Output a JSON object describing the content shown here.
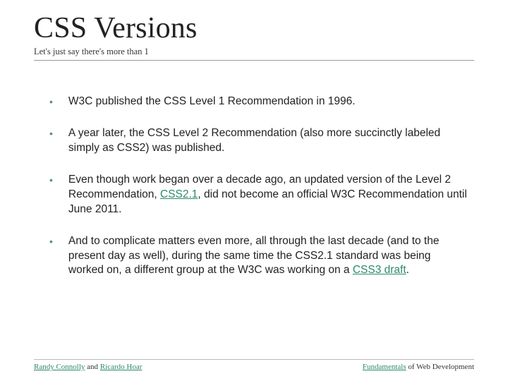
{
  "header": {
    "title": "CSS Versions",
    "subtitle": "Let's just say there's more than 1"
  },
  "bullets": [
    {
      "text": "W3C published the CSS Level 1 Recommendation in 1996."
    },
    {
      "text": "A year later, the CSS Level 2 Recommendation (also more succinctly labeled simply as CSS2) was published."
    }
  ],
  "bullet3": {
    "pre": "Even though work began over a decade ago, an updated version of the Level 2 Recommendation, ",
    "link": "CSS2.1",
    "post": ", did not become an official W3C Recommendation until June 2011."
  },
  "bullet4": {
    "pre": "And to complicate matters even more, all through the last decade (and to the present day as well), during the same time the CSS2.1 standard was being worked on, a different group at the W3C was working on a ",
    "link": "CSS3 draft",
    "post": "."
  },
  "footer": {
    "left_link1": "Randy Connolly",
    "left_mid": " and ",
    "left_link2": "Ricardo Hoar",
    "right_link": "Fundamentals",
    "right_post": " of Web Development"
  }
}
